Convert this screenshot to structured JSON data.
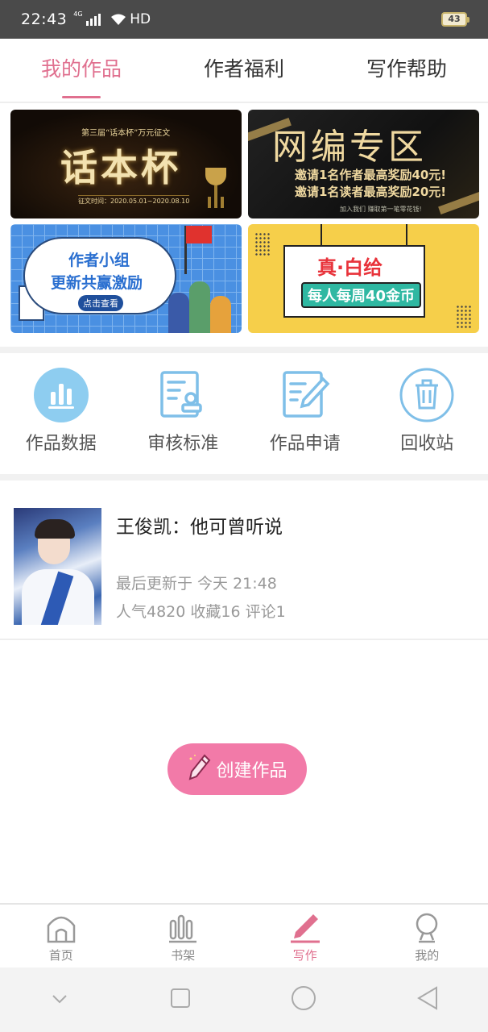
{
  "status_bar": {
    "time": "22:43",
    "network": "4G",
    "hd": "HD",
    "battery": "43"
  },
  "tabs": [
    {
      "label": "我的作品",
      "active": true
    },
    {
      "label": "作者福利",
      "active": false
    },
    {
      "label": "写作帮助",
      "active": false
    }
  ],
  "banners": {
    "b1": {
      "small": "第三届“话本杯”万元征文",
      "big": "话本杯",
      "date": "征文时间：2020.05.01~2020.08.10"
    },
    "b2": {
      "title": "网编专区",
      "line1": "邀请1名作者最高奖励40元!",
      "line2": "邀请1名读者最高奖励20元!",
      "foot": "加入我们 赚取第一笔零花钱!"
    },
    "b3": {
      "line1": "作者小组",
      "line2": "更新共赢激励",
      "button": "点击查看"
    },
    "b4": {
      "line1": "真·白给",
      "line2": "每人每周40金币"
    }
  },
  "actions": [
    {
      "label": "作品数据",
      "icon": "bar-chart-icon"
    },
    {
      "label": "审核标准",
      "icon": "review-stamp-icon"
    },
    {
      "label": "作品申请",
      "icon": "edit-document-icon"
    },
    {
      "label": "回收站",
      "icon": "trash-icon"
    }
  ],
  "work": {
    "title": "王俊凯：他可曾听说",
    "updated": "最后更新于 今天 21:48",
    "stats": "人气4820 收藏16 评论1"
  },
  "create_button": {
    "label": "创建作品"
  },
  "bottom_nav": [
    {
      "label": "首页",
      "active": false
    },
    {
      "label": "书架",
      "active": false
    },
    {
      "label": "写作",
      "active": true
    },
    {
      "label": "我的",
      "active": false
    }
  ],
  "colors": {
    "accent": "#e0708f",
    "create_button": "#f27aa8",
    "icon_blue": "#7fbfe8"
  }
}
